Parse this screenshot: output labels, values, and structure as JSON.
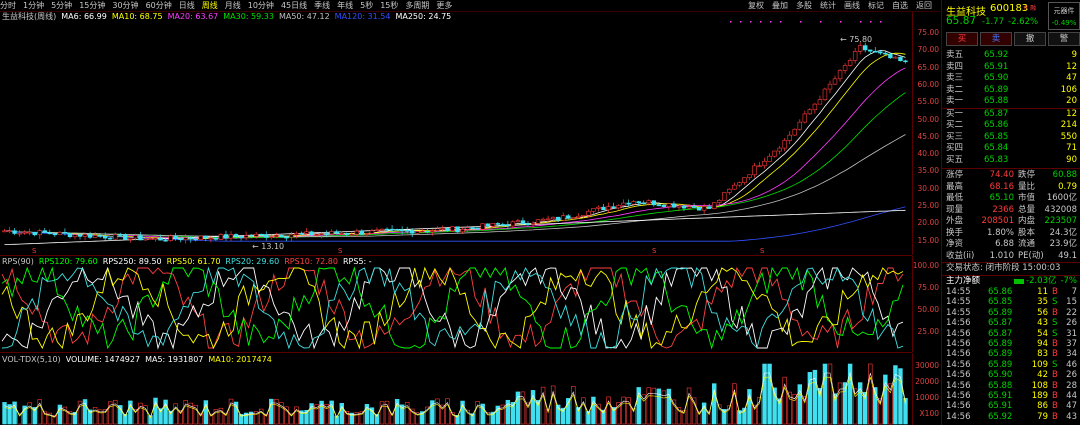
{
  "toolbar": {
    "periods": [
      "分时",
      "1分钟",
      "5分钟",
      "15分钟",
      "30分钟",
      "60分钟",
      "日线",
      "周线",
      "月线",
      "10分钟",
      "45日线",
      "季线",
      "年线",
      "5秒",
      "15秒",
      "多周期",
      "更多"
    ],
    "active_period": "周线",
    "right_tools": [
      "复权",
      "叠加",
      "多股",
      "统计",
      "画线",
      "标记",
      "自选",
      "返回"
    ]
  },
  "main_legend": {
    "name": "生益科技(周线)",
    "items": [
      {
        "label": "MA6: 66.99",
        "color": "#ffffff"
      },
      {
        "label": "MA10: 68.75",
        "color": "#ffff00"
      },
      {
        "label": "MA20: 63.67",
        "color": "#ff3cff"
      },
      {
        "label": "MA30: 59.33",
        "color": "#00e000"
      },
      {
        "label": "MA50: 47.12",
        "color": "#c0c0c0"
      },
      {
        "label": "MA120: 31.54",
        "color": "#3050ff"
      },
      {
        "label": "MA250: 24.75",
        "color": "#ffffff"
      }
    ]
  },
  "price_axis": [
    "75.00",
    "70.00",
    "65.00",
    "60.00",
    "55.00",
    "50.00",
    "45.00",
    "40.00",
    "35.00",
    "30.00",
    "25.00",
    "20.00",
    "15.00"
  ],
  "annotations": {
    "high": "75.80",
    "low": "13.10"
  },
  "rps_legend": {
    "name": "RPS(90)",
    "items": [
      {
        "label": "RPS120: 79.60",
        "color": "#00ff00"
      },
      {
        "label": "RPS250: 89.50",
        "color": "#ffffff"
      },
      {
        "label": "RPS50: 61.70",
        "color": "#ffff00"
      },
      {
        "label": "RPS20: 29.60",
        "color": "#40e0e0"
      },
      {
        "label": "RPS10: 72.80",
        "color": "#ff4040"
      },
      {
        "label": "RPS5: -",
        "color": "#ffffff"
      }
    ]
  },
  "rps_axis": [
    "100.00",
    "75.00",
    "50.00",
    "25.00"
  ],
  "vol_legend": {
    "name": "VOL-TDX(5,10)",
    "items": [
      {
        "label": "VOLUME: 1474927",
        "color": "#ffffff"
      },
      {
        "label": "MA5: 1931807",
        "color": "#ffffff"
      },
      {
        "label": "MA10: 2017474",
        "color": "#ffff00"
      }
    ]
  },
  "vol_axis": [
    "30000",
    "20000",
    "10000",
    "X100"
  ],
  "stock": {
    "name": "生益科技",
    "code": "600183",
    "tag": "R 融",
    "price": "65.87",
    "change": "-1.77",
    "pct": "-2.62%",
    "yuan_label": "元器件",
    "yuan_pct": "-0.49%"
  },
  "trade_buttons": [
    "买",
    "卖",
    "撤",
    "警"
  ],
  "order_book": {
    "sell": [
      {
        "label": "卖五",
        "price": "65.92",
        "vol": "9"
      },
      {
        "label": "卖四",
        "price": "65.91",
        "vol": "12"
      },
      {
        "label": "卖三",
        "price": "65.90",
        "vol": "47"
      },
      {
        "label": "卖二",
        "price": "65.89",
        "vol": "106"
      },
      {
        "label": "卖一",
        "price": "65.88",
        "vol": "20"
      }
    ],
    "buy": [
      {
        "label": "买一",
        "price": "65.87",
        "vol": "12"
      },
      {
        "label": "买二",
        "price": "65.86",
        "vol": "214"
      },
      {
        "label": "买三",
        "price": "65.85",
        "vol": "550"
      },
      {
        "label": "买四",
        "price": "65.84",
        "vol": "71"
      },
      {
        "label": "买五",
        "price": "65.83",
        "vol": "90"
      }
    ]
  },
  "stats": [
    {
      "l1": "涨停",
      "v1": "74.40",
      "c1": "red",
      "l2": "跌停",
      "v2": "60.88",
      "c2": "green"
    },
    {
      "l1": "最高",
      "v1": "68.16",
      "c1": "red",
      "l2": "量比",
      "v2": "0.79",
      "c2": "yellow"
    },
    {
      "l1": "最低",
      "v1": "65.10",
      "c1": "green",
      "l2": "市值",
      "v2": "1600亿",
      "c2": "white"
    },
    {
      "l1": "现量",
      "v1": "2366",
      "c1": "red",
      "l2": "总量",
      "v2": "432008",
      "c2": "white"
    },
    {
      "l1": "外盘",
      "v1": "208501",
      "c1": "red",
      "l2": "内盘",
      "v2": "223507",
      "c2": "green"
    },
    {
      "l1": "换手",
      "v1": "1.80%",
      "c1": "white",
      "l2": "股本",
      "v2": "24.3亿",
      "c2": "white"
    },
    {
      "l1": "净资",
      "v1": "6.88",
      "c1": "white",
      "l2": "流通",
      "v2": "23.9亿",
      "c2": "white"
    },
    {
      "l1": "收益(ii)",
      "v1": "1.010",
      "c1": "white",
      "l2": "PE(动)",
      "v2": "49.1",
      "c2": "white"
    }
  ],
  "trade_status": "交易状态: 闭市阶段 15:00:03",
  "main_flow": {
    "label": "主力净额",
    "value": "-2.03亿",
    "pct": "-7%"
  },
  "ticks": [
    {
      "t": "14:55",
      "p": "65.86",
      "v": "11",
      "d": "B",
      "n": "7"
    },
    {
      "t": "14:55",
      "p": "65.85",
      "v": "35",
      "d": "S",
      "n": "15"
    },
    {
      "t": "14:55",
      "p": "65.89",
      "v": "56",
      "d": "B",
      "n": "22"
    },
    {
      "t": "14:56",
      "p": "65.87",
      "v": "43",
      "d": "S",
      "n": "26"
    },
    {
      "t": "14:56",
      "p": "65.87",
      "v": "54",
      "d": "S",
      "n": "31"
    },
    {
      "t": "14:56",
      "p": "65.89",
      "v": "94",
      "d": "B",
      "n": "37"
    },
    {
      "t": "14:56",
      "p": "65.89",
      "v": "83",
      "d": "B",
      "n": "34"
    },
    {
      "t": "14:56",
      "p": "65.89",
      "v": "109",
      "d": "S",
      "n": "46"
    },
    {
      "t": "14:56",
      "p": "65.90",
      "v": "42",
      "d": "B",
      "n": "26"
    },
    {
      "t": "14:56",
      "p": "65.88",
      "v": "108",
      "d": "B",
      "n": "28"
    },
    {
      "t": "14:56",
      "p": "65.91",
      "v": "189",
      "d": "B",
      "n": "44"
    },
    {
      "t": "14:56",
      "p": "65.91",
      "v": "86",
      "d": "B",
      "n": "47"
    },
    {
      "t": "14:56",
      "p": "65.92",
      "v": "79",
      "d": "B",
      "n": "43"
    }
  ]
}
